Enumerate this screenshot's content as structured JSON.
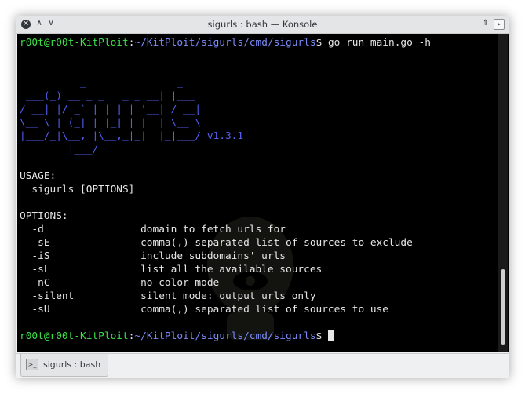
{
  "window": {
    "title": "sigurls : bash — Konsole",
    "close_icon": "✕",
    "up_icon": "∧",
    "down_icon": "∨",
    "keep_above_icon": "⇑",
    "menu_icon": "▸"
  },
  "terminal": {
    "prompt_user": "r00t@r00t-KitPloit",
    "prompt_sep": ":",
    "prompt_path": "~/KitPloit/sigurls/cmd/sigurls",
    "prompt_symbol": "$ ",
    "command": "go run main.go -h",
    "banner": [
      "          _               _",
      " ___(_) __ _ _   _ _ __| |___",
      "/ __| |/ _` | | | | '__| / __|",
      "\\__ \\ | (_| | |_| | |  | \\__ \\",
      "|___/_|\\__, |\\__,_|_|  |_|___/"
    ],
    "version": " v1.3.1",
    "banner_last": "        |___/",
    "usage_header": "USAGE:",
    "usage_line": "  sigurls [OPTIONS]",
    "options_header": "OPTIONS:",
    "options": [
      {
        "flag": "  -d                ",
        "desc": "domain to fetch urls for"
      },
      {
        "flag": "  -sE               ",
        "desc": "comma(,) separated list of sources to exclude"
      },
      {
        "flag": "  -iS               ",
        "desc": "include subdomains' urls"
      },
      {
        "flag": "  -sL               ",
        "desc": "list all the available sources"
      },
      {
        "flag": "  -nC               ",
        "desc": "no color mode"
      },
      {
        "flag": "  -silent           ",
        "desc": "silent mode: output urls only"
      },
      {
        "flag": "  -sU               ",
        "desc": "comma(,) separated list of sources to use"
      }
    ]
  },
  "tabs": [
    {
      "label": "sigurls : bash",
      "icon": "terminal-icon"
    }
  ],
  "colors": {
    "prompt_user": "#3ee048",
    "prompt_path": "#7a8af5",
    "banner": "#5560f0",
    "background": "#000000"
  }
}
